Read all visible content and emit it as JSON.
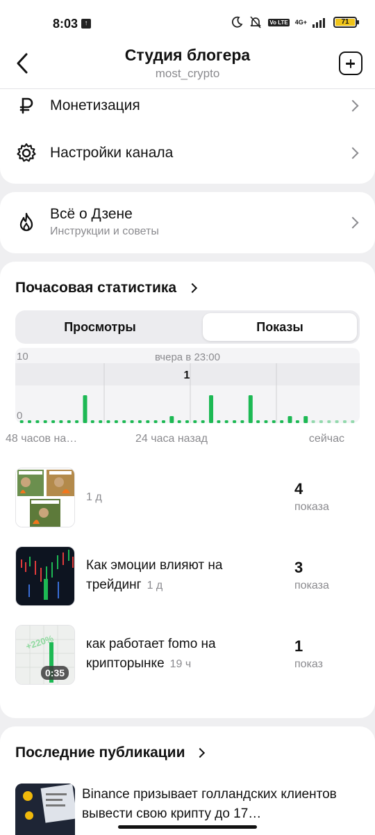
{
  "status_bar": {
    "time": "8:03",
    "battery": "71",
    "network": "4G+",
    "volte": "Vo LTE"
  },
  "header": {
    "title": "Студия блогера",
    "subtitle": "most_crypto"
  },
  "menu": {
    "items": [
      {
        "label": "Монетизация",
        "icon": "ruble-icon"
      },
      {
        "label": "Настройки канала",
        "icon": "gear-icon"
      }
    ]
  },
  "dzen": {
    "title": "Всё о Дзене",
    "subtitle": "Инструкции и советы",
    "icon": "flame-icon"
  },
  "hourly": {
    "title": "Почасовая статистика",
    "tabs": [
      "Просмотры",
      "Показы"
    ],
    "active_tab": "Показы"
  },
  "chart_data": {
    "type": "bar",
    "ylim": [
      0,
      10
    ],
    "y_top_label": "10",
    "y_bottom_label": "0",
    "tooltip_label": "вчера в 23:00",
    "tooltip_value": "1",
    "x_labels": [
      "48 часов на…",
      "24 часа назад",
      "сейчас"
    ],
    "values": [
      0,
      0,
      0,
      0,
      0,
      0,
      0,
      0,
      4,
      0,
      0,
      0,
      0,
      0,
      0,
      0,
      0,
      0,
      0,
      1,
      0,
      0,
      0,
      0,
      4,
      0,
      0,
      0,
      0,
      4,
      0,
      0,
      0,
      0,
      1,
      0,
      1,
      0,
      0,
      0,
      0,
      0,
      0
    ],
    "highlighted_index": 24,
    "color": "#1db954"
  },
  "posts": [
    {
      "title": "",
      "age": "1 д",
      "count": "4",
      "unit": "показа",
      "thumb": "comic"
    },
    {
      "title": "Как эмоции влияют на трейдинг",
      "age": "1 д",
      "count": "3",
      "unit": "показа",
      "thumb": "candles"
    },
    {
      "title": "как работает fomo на крипторынке",
      "age": "19 ч",
      "count": "1",
      "unit": "показ",
      "thumb": "video",
      "duration": "0:35"
    }
  ],
  "latest": {
    "title": "Последние публикации",
    "text": "Binance призывает голландских клиентов вывести свою крипту до 17…"
  }
}
